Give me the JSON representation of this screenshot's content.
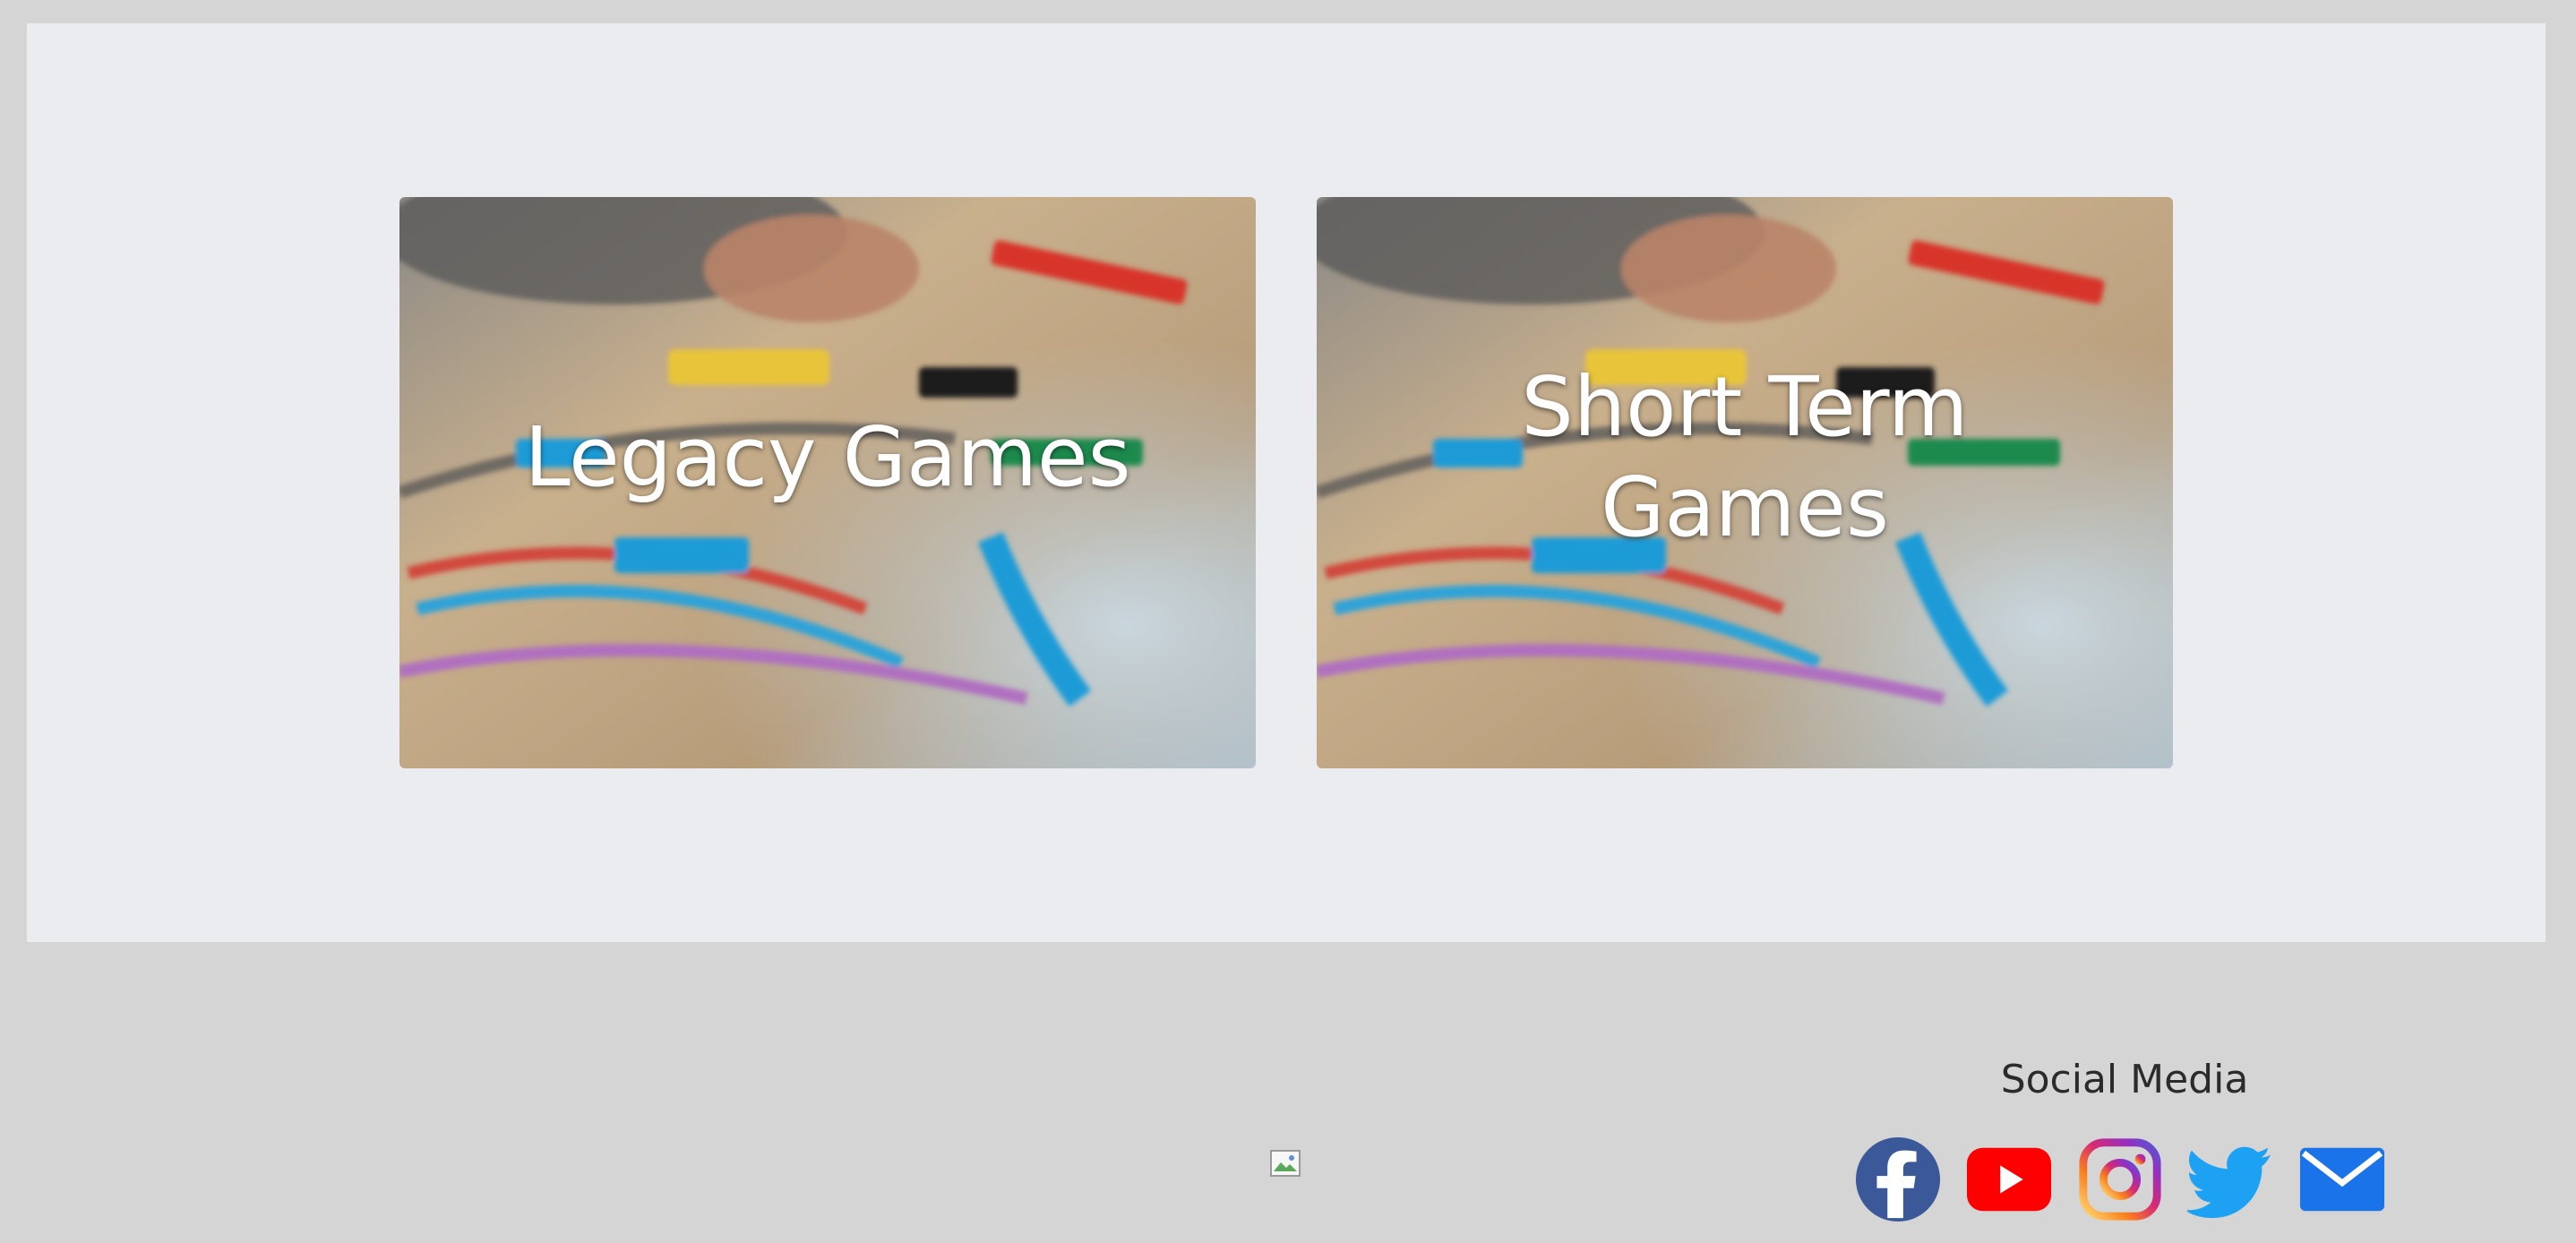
{
  "cards": [
    {
      "title": "Legacy Games"
    },
    {
      "title": "Short Term Games"
    }
  ],
  "footer": {
    "social_heading": "Social Media",
    "icons": [
      "facebook-icon",
      "youtube-icon",
      "instagram-icon",
      "twitter-icon",
      "email-icon"
    ]
  },
  "colors": {
    "page_bg": "#d5d5d5",
    "panel_bg": "#ebecef",
    "facebook": "#3b5998",
    "youtube": "#ff0000",
    "twitter": "#1da1f2",
    "email": "#1a73e8"
  }
}
